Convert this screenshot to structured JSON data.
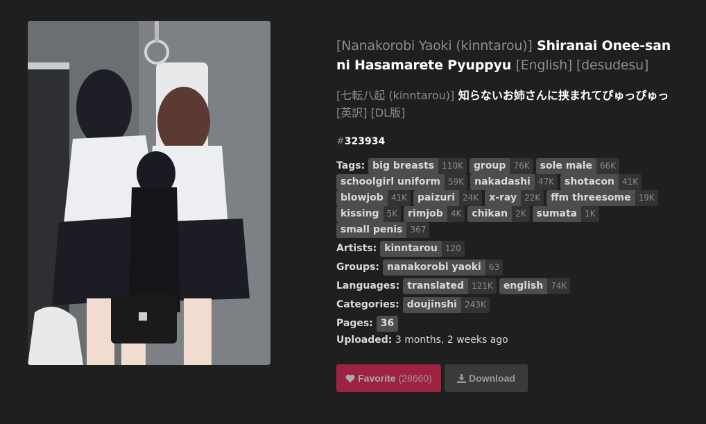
{
  "title": {
    "prefix": "[Nanakorobi Yaoki (kinntarou)]",
    "main": "Shiranai Onee-san ni Hasamarete Pyuppyu",
    "suffix": "[English] [desudesu]"
  },
  "title_japanese": {
    "prefix": "[七転八起 (kinntarou)]",
    "main": "知らないお姉さんに挟まれてぴゅっぴゅっ",
    "suffix": "[英訳] [DL版]"
  },
  "gallery_id": {
    "hash": "#",
    "number": "323934"
  },
  "tag_rows": [
    {
      "label": "Tags:",
      "tags": [
        {
          "name": "big breasts",
          "count": "110K"
        },
        {
          "name": "group",
          "count": "76K"
        },
        {
          "name": "sole male",
          "count": "66K"
        },
        {
          "name": "schoolgirl uniform",
          "count": "59K"
        },
        {
          "name": "nakadashi",
          "count": "47K"
        },
        {
          "name": "shotacon",
          "count": "41K"
        },
        {
          "name": "blowjob",
          "count": "41K"
        },
        {
          "name": "paizuri",
          "count": "24K"
        },
        {
          "name": "x-ray",
          "count": "22K"
        },
        {
          "name": "ffm threesome",
          "count": "19K"
        },
        {
          "name": "kissing",
          "count": "5K"
        },
        {
          "name": "rimjob",
          "count": "4K"
        },
        {
          "name": "chikan",
          "count": "2K"
        },
        {
          "name": "sumata",
          "count": "1K"
        },
        {
          "name": "small penis",
          "count": "367"
        }
      ]
    },
    {
      "label": "Artists:",
      "tags": [
        {
          "name": "kinntarou",
          "count": "120"
        }
      ]
    },
    {
      "label": "Groups:",
      "tags": [
        {
          "name": "nanakorobi yaoki",
          "count": "63"
        }
      ]
    },
    {
      "label": "Languages:",
      "tags": [
        {
          "name": "translated",
          "count": "121K"
        },
        {
          "name": "english",
          "count": "74K"
        }
      ]
    },
    {
      "label": "Categories:",
      "tags": [
        {
          "name": "doujinshi",
          "count": "243K"
        }
      ]
    },
    {
      "label": "Pages:",
      "tags": [
        {
          "name": "36",
          "count": ""
        }
      ]
    }
  ],
  "uploaded": {
    "label": "Uploaded:",
    "value": "3 months, 2 weeks ago"
  },
  "favorite": {
    "label": "Favorite",
    "count": "(28660)"
  },
  "download": {
    "label": "Download"
  },
  "colors": {
    "accent": "#ed2553",
    "background": "#1f1f1f",
    "tag_bg": "#4d4d4d"
  }
}
